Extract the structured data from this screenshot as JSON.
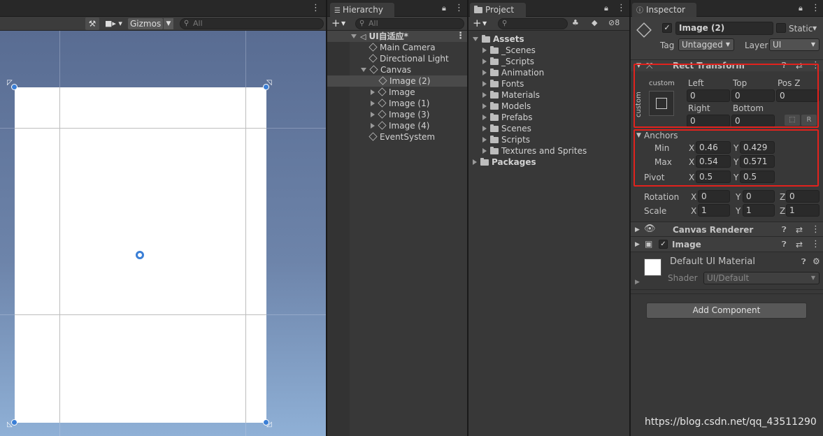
{
  "scene": {
    "gizmos_label": "Gizmos",
    "search_placeholder": "All"
  },
  "hierarchy": {
    "tab_label": "Hierarchy",
    "add_label": "+",
    "search_placeholder": "All",
    "scene_name": "UI自适应*",
    "items": [
      "Main Camera",
      "Directional Light",
      "Canvas",
      "Image (2)",
      "Image",
      "Image (1)",
      "Image (3)",
      "Image (4)",
      "EventSystem"
    ]
  },
  "project": {
    "tab_label": "Project",
    "add_label": "+",
    "badge_count": "8",
    "assets_label": "Assets",
    "folders": [
      "_Scenes",
      "_Scripts",
      "Animation",
      "Fonts",
      "Materials",
      "Models",
      "Prefabs",
      "Scenes",
      "Scripts",
      "Textures and Sprites"
    ],
    "packages_label": "Packages"
  },
  "inspector": {
    "tab_label": "Inspector",
    "object_name": "Image (2)",
    "static_label": "Static",
    "tag_label": "Tag",
    "tag_value": "Untagged",
    "layer_label": "Layer",
    "layer_value": "UI",
    "rect_transform_label": "Rect Transform",
    "anchor_preset_top": "custom",
    "anchor_preset_side": "custom",
    "left_label": "Left",
    "left_value": "0",
    "top_label": "Top",
    "top_value": "0",
    "posz_label": "Pos Z",
    "posz_value": "0",
    "right_label": "Right",
    "right_value": "0",
    "bottom_label": "Bottom",
    "bottom_value": "0",
    "r_button": "R",
    "anchors_label": "Anchors",
    "min_label": "Min",
    "min_x": "0.46",
    "min_y": "0.429",
    "max_label": "Max",
    "max_x": "0.54",
    "max_y": "0.571",
    "pivot_label": "Pivot",
    "pivot_x": "0.5",
    "pivot_y": "0.5",
    "rotation_label": "Rotation",
    "rot_x": "0",
    "rot_y": "0",
    "rot_z": "0",
    "scale_label": "Scale",
    "scale_x": "1",
    "scale_y": "1",
    "scale_z": "1",
    "x_axis": "X",
    "y_axis": "Y",
    "z_axis": "Z",
    "canvas_renderer_label": "Canvas Renderer",
    "image_label": "Image",
    "material_label": "Default UI Material",
    "shader_label": "Shader",
    "shader_value": "UI/Default",
    "add_component_label": "Add Component"
  },
  "watermark": "https://blog.csdn.net/qq_43511290",
  "colors": {
    "highlight_red": "#e2221d",
    "anchor_blue": "#3b7fd6"
  }
}
